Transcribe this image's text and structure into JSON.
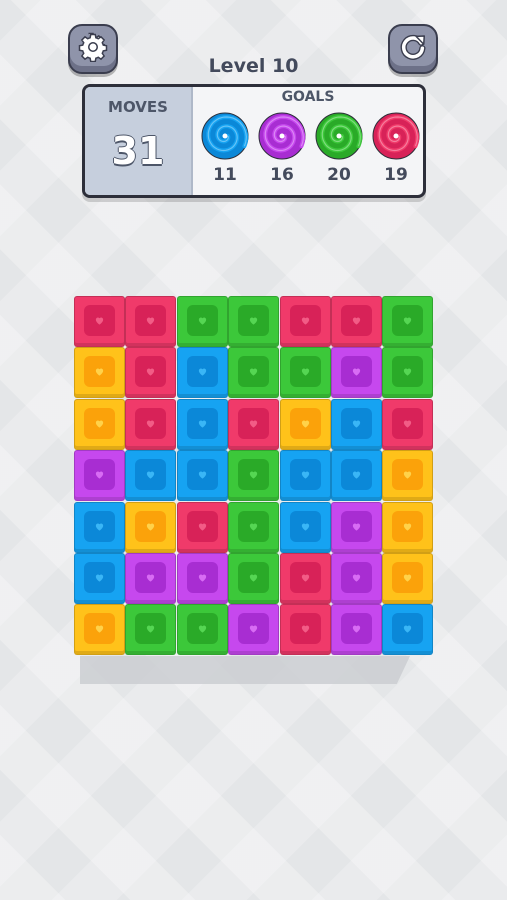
{
  "header": {
    "settings_icon": "gear-icon",
    "restart_icon": "restart-icon",
    "level_title": "Level 10"
  },
  "hud": {
    "moves_label": "MOVES",
    "moves_value": "31",
    "goals_label": "GOALS",
    "goals": [
      {
        "color": "blue",
        "count": "11"
      },
      {
        "color": "purple",
        "count": "16"
      },
      {
        "color": "green",
        "count": "20"
      },
      {
        "color": "red",
        "count": "19"
      }
    ]
  },
  "colors": {
    "red": {
      "base": "#f03a6a",
      "inner": "#d82258",
      "heart": "#f25c86"
    },
    "green": {
      "base": "#3cc83a",
      "inner": "#2aaa28",
      "heart": "#55d653"
    },
    "blue": {
      "base": "#16a3f2",
      "inner": "#0b88d8",
      "heart": "#3ab6f6"
    },
    "purple": {
      "base": "#c648ee",
      "inner": "#a82dd2",
      "heart": "#d86cf4"
    },
    "yellow": {
      "base": "#ffc21a",
      "inner": "#fba20a",
      "heart": "#ffd24a"
    }
  },
  "board": {
    "rows": 7,
    "cols": 7,
    "tile_icon": "heart-icon",
    "grid": [
      [
        "red",
        "red",
        "green",
        "green",
        "red",
        "red",
        "green"
      ],
      [
        "yellow",
        "red",
        "blue",
        "green",
        "green",
        "purple",
        "green"
      ],
      [
        "yellow",
        "red",
        "blue",
        "red",
        "yellow",
        "blue",
        "red"
      ],
      [
        "purple",
        "blue",
        "blue",
        "green",
        "blue",
        "blue",
        "yellow"
      ],
      [
        "blue",
        "yellow",
        "red",
        "green",
        "blue",
        "purple",
        "yellow"
      ],
      [
        "blue",
        "purple",
        "purple",
        "green",
        "red",
        "purple",
        "yellow"
      ],
      [
        "yellow",
        "green",
        "green",
        "purple",
        "red",
        "purple",
        "blue"
      ]
    ]
  }
}
